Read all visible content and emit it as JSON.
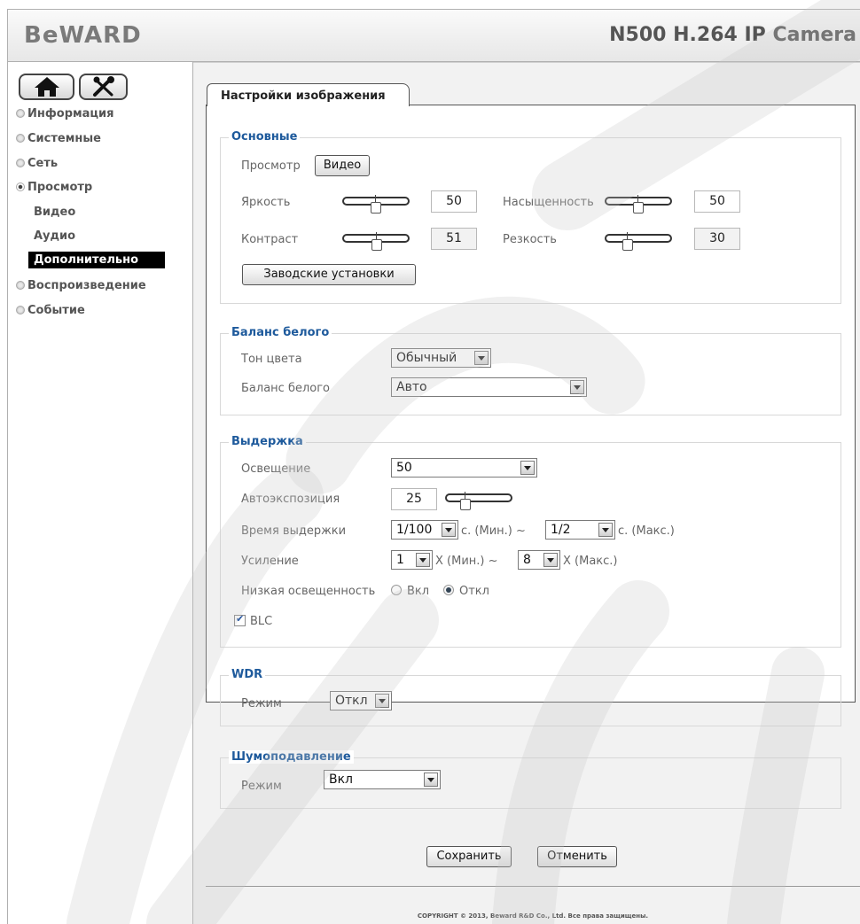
{
  "header": {
    "logo": "BeWARD",
    "model": "N500 H.264 IP Camera"
  },
  "toolbar": {
    "home_icon": "home-icon",
    "settings_icon": "tools-icon"
  },
  "sidebar": {
    "items": [
      {
        "label": "Информация"
      },
      {
        "label": "Системные"
      },
      {
        "label": "Сеть"
      },
      {
        "label": "Просмотр",
        "expanded": true
      },
      {
        "label": "Воспроизведение"
      },
      {
        "label": "Событие"
      }
    ],
    "subitems": [
      {
        "label": "Видео"
      },
      {
        "label": "Аудио"
      },
      {
        "label": "Дополнительно",
        "active": true
      }
    ]
  },
  "tab": {
    "label": "Настройки изображения"
  },
  "basic": {
    "legend": "Основные",
    "preview_label": "Просмотр",
    "preview_button": "Видео",
    "brightness": {
      "label": "Яркость",
      "value": "50",
      "level": 50
    },
    "saturation": {
      "label": "Насыщенность",
      "value": "50",
      "level": 50
    },
    "contrast": {
      "label": "Контраст",
      "value": "51",
      "level": 51
    },
    "sharpness": {
      "label": "Резкость",
      "value": "30",
      "level": 30
    },
    "factory_button": "Заводские установки"
  },
  "white_balance": {
    "legend": "Баланс белого",
    "tone_label": "Тон цвета",
    "tone_value": "Обычный",
    "wb_label": "Баланс белого",
    "wb_value": "Авто"
  },
  "exposure": {
    "legend": "Выдержка",
    "lighting_label": "Освещение",
    "lighting_value": "50",
    "ae_label": "Автоэкспозиция",
    "ae_value": "25",
    "ae_level": 25,
    "shutter_label": "Время выдержки",
    "shutter_min": "1/100",
    "shutter_min_unit": "с.  (Мин.) ~",
    "shutter_max": "1/2",
    "shutter_max_unit": "с.  (Макс.)",
    "gain_label": "Усиление",
    "gain_min": "1",
    "gain_min_unit": "X  (Мин.) ~",
    "gain_max": "8",
    "gain_max_unit": "X  (Макс.)",
    "lowlight_label": "Низкая освещенность",
    "on_label": "Вкл",
    "off_label": "Откл",
    "lowlight_selected": "Откл",
    "blc_label": "BLC",
    "blc_checked": true
  },
  "wdr": {
    "legend": "WDR",
    "mode_label": "Режим",
    "mode_value": "Откл"
  },
  "noise": {
    "legend": "Шумоподавление",
    "mode_label": "Режим",
    "mode_value": "Вкл"
  },
  "actions": {
    "save": "Сохранить",
    "cancel": "Отменить"
  },
  "footer": {
    "copyright": "COPYRIGHT © 2013, Beward R&D Co., Ltd. Все права защищены."
  },
  "colors": {
    "legend": "#1e5a9c",
    "active_nav_bg": "#000000",
    "watermark": "#d6d6d6"
  }
}
